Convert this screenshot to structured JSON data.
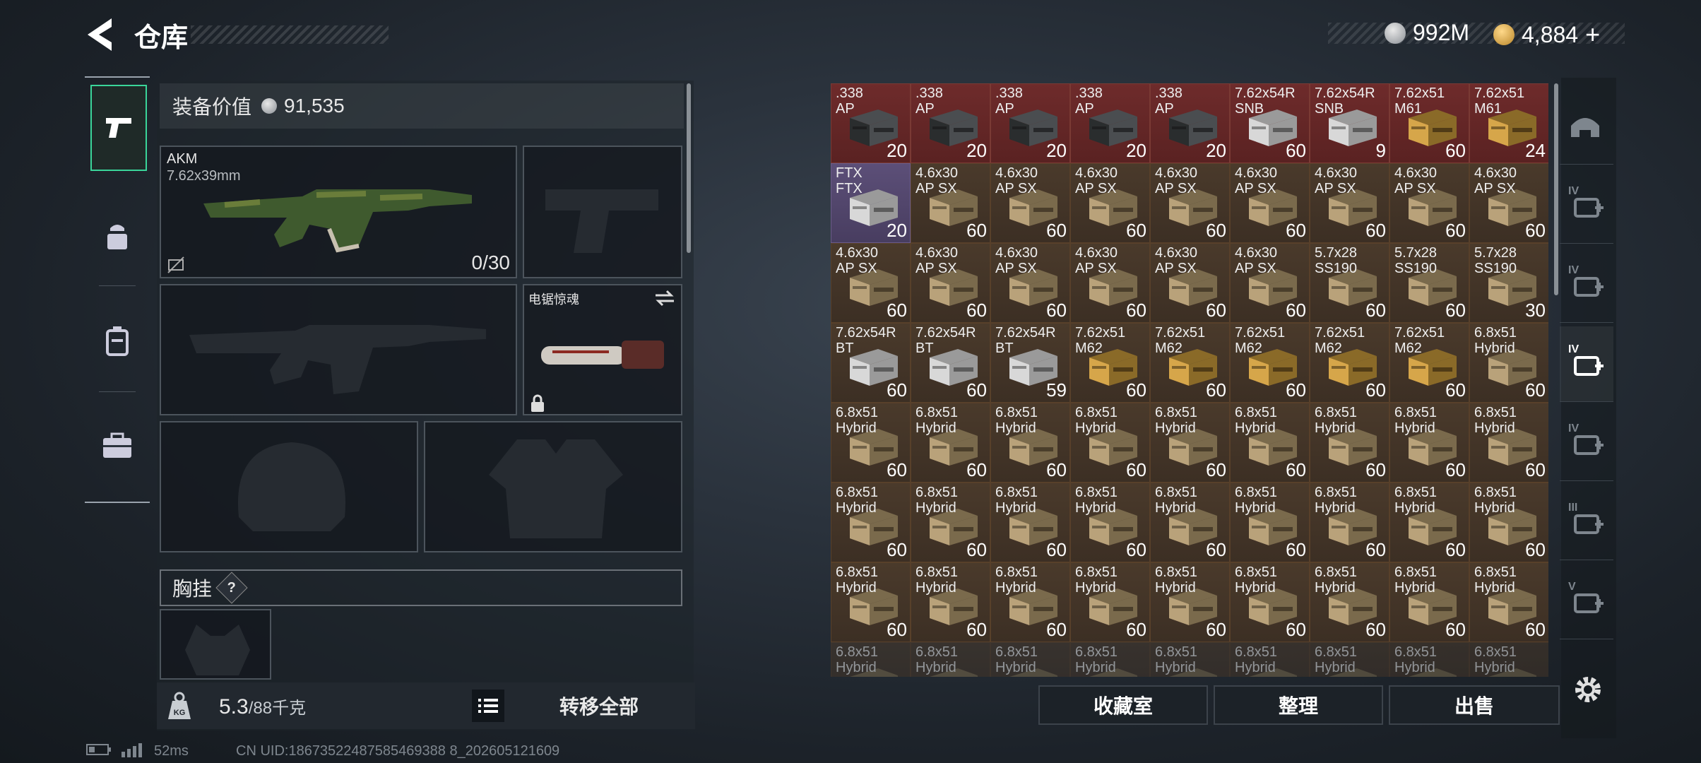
{
  "header": {
    "title": "仓库"
  },
  "currency": {
    "coins": "992M",
    "tokens": "4,884",
    "add_label": "+"
  },
  "sidebar": {
    "items": [
      {
        "id": "weapons",
        "icon": "pistol-icon",
        "active": true
      },
      {
        "id": "gear",
        "icon": "helmet-vest-icon",
        "active": false
      },
      {
        "id": "backpack",
        "icon": "backpack-icon",
        "active": false
      },
      {
        "id": "case",
        "icon": "briefcase-icon",
        "active": false
      }
    ]
  },
  "loadout": {
    "value_label": "装备价值",
    "value": "91,535",
    "primary": {
      "name": "AKM",
      "caliber": "7.62x39mm",
      "ammo": "0/30"
    },
    "melee": {
      "name": "电锯惊魂"
    },
    "chest_rig_label": "胸挂",
    "chest_rig_help": "?",
    "weight_current": "5.3",
    "weight_max": "/88千克",
    "transfer_all": "转移全部"
  },
  "inventory": {
    "cells": [
      {
        "name": ".338\nAP",
        "qty": "20",
        "color": "red",
        "box": "dark"
      },
      {
        "name": ".338\nAP",
        "qty": "20",
        "color": "red",
        "box": "dark"
      },
      {
        "name": ".338\nAP",
        "qty": "20",
        "color": "red",
        "box": "dark"
      },
      {
        "name": ".338\nAP",
        "qty": "20",
        "color": "red",
        "box": "dark"
      },
      {
        "name": ".338\nAP",
        "qty": "20",
        "color": "red",
        "box": "dark"
      },
      {
        "name": "7.62x54R\nSNB",
        "qty": "60",
        "color": "red",
        "box": "white"
      },
      {
        "name": "7.62x54R\nSNB",
        "qty": "9",
        "color": "red",
        "box": "white"
      },
      {
        "name": "7.62x51\nM61",
        "qty": "60",
        "color": "red",
        "box": "gold"
      },
      {
        "name": "7.62x51\nM61",
        "qty": "24",
        "color": "red",
        "box": "gold"
      },
      {
        "name": "FTX\nFTX",
        "qty": "20",
        "color": "purple",
        "box": "white"
      },
      {
        "name": "4.6x30\nAP SX",
        "qty": "60",
        "color": "brown",
        "box": "tan"
      },
      {
        "name": "4.6x30\nAP SX",
        "qty": "60",
        "color": "brown",
        "box": "tan"
      },
      {
        "name": "4.6x30\nAP SX",
        "qty": "60",
        "color": "brown",
        "box": "tan"
      },
      {
        "name": "4.6x30\nAP SX",
        "qty": "60",
        "color": "brown",
        "box": "tan"
      },
      {
        "name": "4.6x30\nAP SX",
        "qty": "60",
        "color": "brown",
        "box": "tan"
      },
      {
        "name": "4.6x30\nAP SX",
        "qty": "60",
        "color": "brown",
        "box": "tan"
      },
      {
        "name": "4.6x30\nAP SX",
        "qty": "60",
        "color": "brown",
        "box": "tan"
      },
      {
        "name": "4.6x30\nAP SX",
        "qty": "60",
        "color": "brown",
        "box": "tan"
      },
      {
        "name": "4.6x30\nAP SX",
        "qty": "60",
        "color": "brown",
        "box": "tan"
      },
      {
        "name": "4.6x30\nAP SX",
        "qty": "60",
        "color": "brown",
        "box": "tan"
      },
      {
        "name": "4.6x30\nAP SX",
        "qty": "60",
        "color": "brown",
        "box": "tan"
      },
      {
        "name": "4.6x30\nAP SX",
        "qty": "60",
        "color": "brown",
        "box": "tan"
      },
      {
        "name": "4.6x30\nAP SX",
        "qty": "60",
        "color": "brown",
        "box": "tan"
      },
      {
        "name": "4.6x30\nAP SX",
        "qty": "60",
        "color": "brown",
        "box": "tan"
      },
      {
        "name": "5.7x28\nSS190",
        "qty": "60",
        "color": "brown",
        "box": "tan"
      },
      {
        "name": "5.7x28\nSS190",
        "qty": "60",
        "color": "brown",
        "box": "tan"
      },
      {
        "name": "5.7x28\nSS190",
        "qty": "30",
        "color": "brown",
        "box": "tan"
      },
      {
        "name": "7.62x54R\nBT",
        "qty": "60",
        "color": "brown",
        "box": "white"
      },
      {
        "name": "7.62x54R\nBT",
        "qty": "60",
        "color": "brown",
        "box": "white"
      },
      {
        "name": "7.62x54R\nBT",
        "qty": "59",
        "color": "brown",
        "box": "white"
      },
      {
        "name": "7.62x51\nM62",
        "qty": "60",
        "color": "brown",
        "box": "gold"
      },
      {
        "name": "7.62x51\nM62",
        "qty": "60",
        "color": "brown",
        "box": "gold"
      },
      {
        "name": "7.62x51\nM62",
        "qty": "60",
        "color": "brown",
        "box": "gold"
      },
      {
        "name": "7.62x51\nM62",
        "qty": "60",
        "color": "brown",
        "box": "gold"
      },
      {
        "name": "7.62x51\nM62",
        "qty": "60",
        "color": "brown",
        "box": "gold"
      },
      {
        "name": "6.8x51\nHybrid",
        "qty": "60",
        "color": "brown",
        "box": "tan"
      },
      {
        "name": "6.8x51\nHybrid",
        "qty": "60",
        "color": "brown",
        "box": "tan"
      },
      {
        "name": "6.8x51\nHybrid",
        "qty": "60",
        "color": "brown",
        "box": "tan"
      },
      {
        "name": "6.8x51\nHybrid",
        "qty": "60",
        "color": "brown",
        "box": "tan"
      },
      {
        "name": "6.8x51\nHybrid",
        "qty": "60",
        "color": "brown",
        "box": "tan"
      },
      {
        "name": "6.8x51\nHybrid",
        "qty": "60",
        "color": "brown",
        "box": "tan"
      },
      {
        "name": "6.8x51\nHybrid",
        "qty": "60",
        "color": "brown",
        "box": "tan"
      },
      {
        "name": "6.8x51\nHybrid",
        "qty": "60",
        "color": "brown",
        "box": "tan"
      },
      {
        "name": "6.8x51\nHybrid",
        "qty": "60",
        "color": "brown",
        "box": "tan"
      },
      {
        "name": "6.8x51\nHybrid",
        "qty": "60",
        "color": "brown",
        "box": "tan"
      },
      {
        "name": "6.8x51\nHybrid",
        "qty": "60",
        "color": "brown",
        "box": "tan"
      },
      {
        "name": "6.8x51\nHybrid",
        "qty": "60",
        "color": "brown",
        "box": "tan"
      },
      {
        "name": "6.8x51\nHybrid",
        "qty": "60",
        "color": "brown",
        "box": "tan"
      },
      {
        "name": "6.8x51\nHybrid",
        "qty": "60",
        "color": "brown",
        "box": "tan"
      },
      {
        "name": "6.8x51\nHybrid",
        "qty": "60",
        "color": "brown",
        "box": "tan"
      },
      {
        "name": "6.8x51\nHybrid",
        "qty": "60",
        "color": "brown",
        "box": "tan"
      },
      {
        "name": "6.8x51\nHybrid",
        "qty": "60",
        "color": "brown",
        "box": "tan"
      },
      {
        "name": "6.8x51\nHybrid",
        "qty": "60",
        "color": "brown",
        "box": "tan"
      },
      {
        "name": "6.8x51\nHybrid",
        "qty": "60",
        "color": "brown",
        "box": "tan"
      },
      {
        "name": "6.8x51\nHybrid",
        "qty": "60",
        "color": "brown",
        "box": "tan"
      },
      {
        "name": "6.8x51\nHybrid",
        "qty": "60",
        "color": "brown",
        "box": "tan"
      },
      {
        "name": "6.8x51\nHybrid",
        "qty": "60",
        "color": "brown",
        "box": "tan"
      },
      {
        "name": "6.8x51\nHybrid",
        "qty": "60",
        "color": "brown",
        "box": "tan"
      },
      {
        "name": "6.8x51\nHybrid",
        "qty": "60",
        "color": "brown",
        "box": "tan"
      },
      {
        "name": "6.8x51\nHybrid",
        "qty": "60",
        "color": "brown",
        "box": "tan"
      },
      {
        "name": "6.8x51\nHybrid",
        "qty": "60",
        "color": "brown",
        "box": "tan"
      },
      {
        "name": "6.8x51\nHybrid",
        "qty": "60",
        "color": "brown",
        "box": "tan"
      },
      {
        "name": "6.8x51\nHybrid",
        "qty": "60",
        "color": "brown",
        "box": "tan"
      },
      {
        "name": "6.8x51\nHybrid",
        "qty": "",
        "color": "brown",
        "box": "tan",
        "dim": true
      },
      {
        "name": "6.8x51\nHybrid",
        "qty": "",
        "color": "brown",
        "box": "tan",
        "dim": true
      },
      {
        "name": "6.8x51\nHybrid",
        "qty": "",
        "color": "brown",
        "box": "tan",
        "dim": true
      },
      {
        "name": "6.8x51\nHybrid",
        "qty": "",
        "color": "brown",
        "box": "tan",
        "dim": true
      },
      {
        "name": "6.8x51\nHybrid",
        "qty": "",
        "color": "brown",
        "box": "tan",
        "dim": true
      },
      {
        "name": "6.8x51\nHybrid",
        "qty": "",
        "color": "brown",
        "box": "tan",
        "dim": true
      },
      {
        "name": "6.8x51\nHybrid",
        "qty": "",
        "color": "brown",
        "box": "tan",
        "dim": true
      },
      {
        "name": "6.8x51\nHybrid",
        "qty": "",
        "color": "brown",
        "box": "tan",
        "dim": true
      },
      {
        "name": "6.8x51\nHybrid",
        "qty": "",
        "color": "brown",
        "box": "tan",
        "dim": true
      }
    ]
  },
  "categories": [
    {
      "icon": "helmet-category-icon",
      "label": ""
    },
    {
      "icon": "med-kit-iv-icon",
      "label": "IV"
    },
    {
      "icon": "med-kit-iv-2-icon",
      "label": "IV"
    },
    {
      "icon": "ammo-iv-icon",
      "label": "IV",
      "active": true
    },
    {
      "icon": "ammo-iv-2-icon",
      "label": "IV"
    },
    {
      "icon": "key-iii-icon",
      "label": "III"
    },
    {
      "icon": "tool-v-icon",
      "label": "V"
    }
  ],
  "actions": {
    "collection": "收藏室",
    "sort": "整理",
    "sell": "出售"
  },
  "status": {
    "ping": "52ms",
    "uid": "CN UID:18673522487585469388 8_202605121609"
  }
}
